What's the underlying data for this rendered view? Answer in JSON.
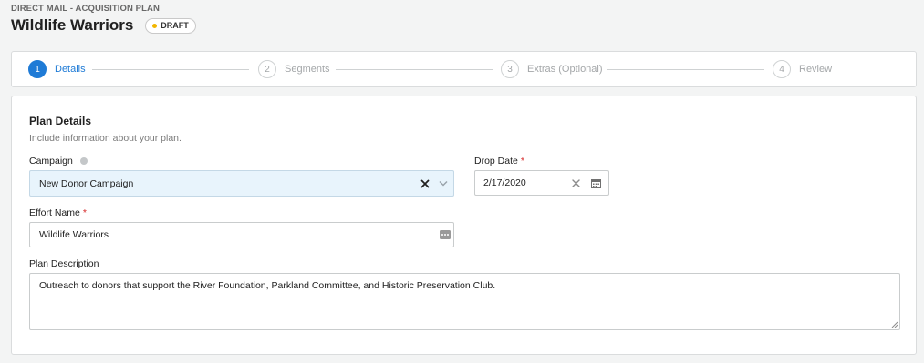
{
  "header": {
    "eyebrow": "DIRECT MAIL - ACQUISITION PLAN",
    "title": "Wildlife Warriors",
    "status": "DRAFT",
    "status_color": "#f2b600"
  },
  "stepper": {
    "active_index": 0,
    "accent_color": "#1f7bd6",
    "steps": [
      {
        "number": "1",
        "label": "Details"
      },
      {
        "number": "2",
        "label": "Segments"
      },
      {
        "number": "3",
        "label": "Extras (Optional)"
      },
      {
        "number": "4",
        "label": "Review"
      }
    ]
  },
  "form": {
    "section_title": "Plan Details",
    "section_subtitle": "Include information about your plan.",
    "campaign": {
      "label": "Campaign",
      "value": "New Donor Campaign",
      "icons": [
        "help-icon",
        "clear-icon",
        "chevron-down-icon"
      ]
    },
    "drop_date": {
      "label": "Drop Date",
      "required_mark": "*",
      "value": "2/17/2020",
      "icons": [
        "clear-icon",
        "calendar-icon"
      ]
    },
    "effort_name": {
      "label": "Effort Name",
      "required_mark": "*",
      "value": "Wildlife Warriors",
      "icons": [
        "more-options-icon"
      ]
    },
    "plan_description": {
      "label": "Plan Description",
      "value": "Outreach to donors that support the River Foundation, Parkland Committee, and Historic Preservation Club."
    }
  }
}
